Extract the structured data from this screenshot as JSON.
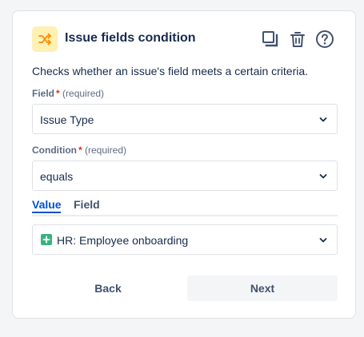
{
  "header": {
    "title": "Issue fields condition",
    "icon": "branch-shuffle-icon",
    "icon_bg_color": "#fff0b3",
    "icon_color": "#ff8b00",
    "actions": [
      "copy-icon",
      "trash-icon",
      "help-icon"
    ]
  },
  "description": "Checks whether an issue's field meets a certain criteria.",
  "field": {
    "label": "Field",
    "required_mark": "*",
    "required_text": "(required)",
    "value": "Issue Type"
  },
  "condition": {
    "label": "Condition",
    "required_mark": "*",
    "required_text": "(required)",
    "value": "equals"
  },
  "value_tabs": {
    "tabs": [
      "Value",
      "Field"
    ],
    "active": "Value"
  },
  "value_select": {
    "value": "HR: Employee onboarding",
    "icon": "plus-square-icon",
    "icon_color": "#36b37e"
  },
  "buttons": {
    "back": "Back",
    "next": "Next"
  },
  "colors": {
    "accent": "#0052cc",
    "required": "#de350b",
    "text": "#172b4d"
  }
}
